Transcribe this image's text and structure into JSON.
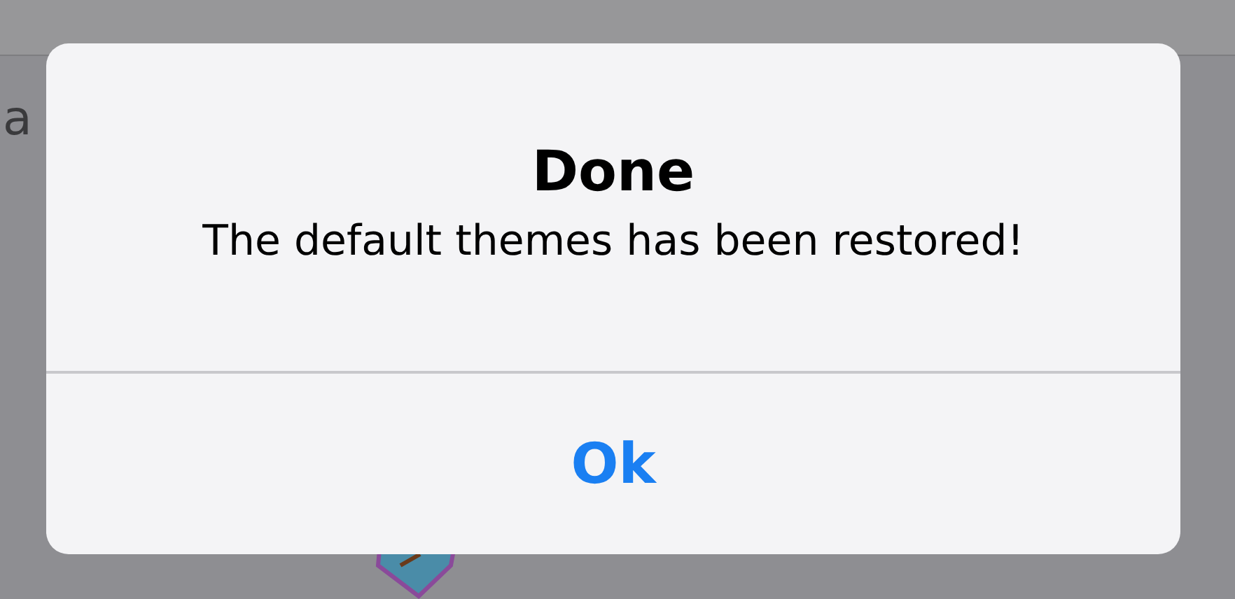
{
  "background": {
    "text_fragment": "a"
  },
  "alert": {
    "title": "Done",
    "message": "The default themes has been restored!",
    "buttons": [
      "Ok"
    ]
  }
}
